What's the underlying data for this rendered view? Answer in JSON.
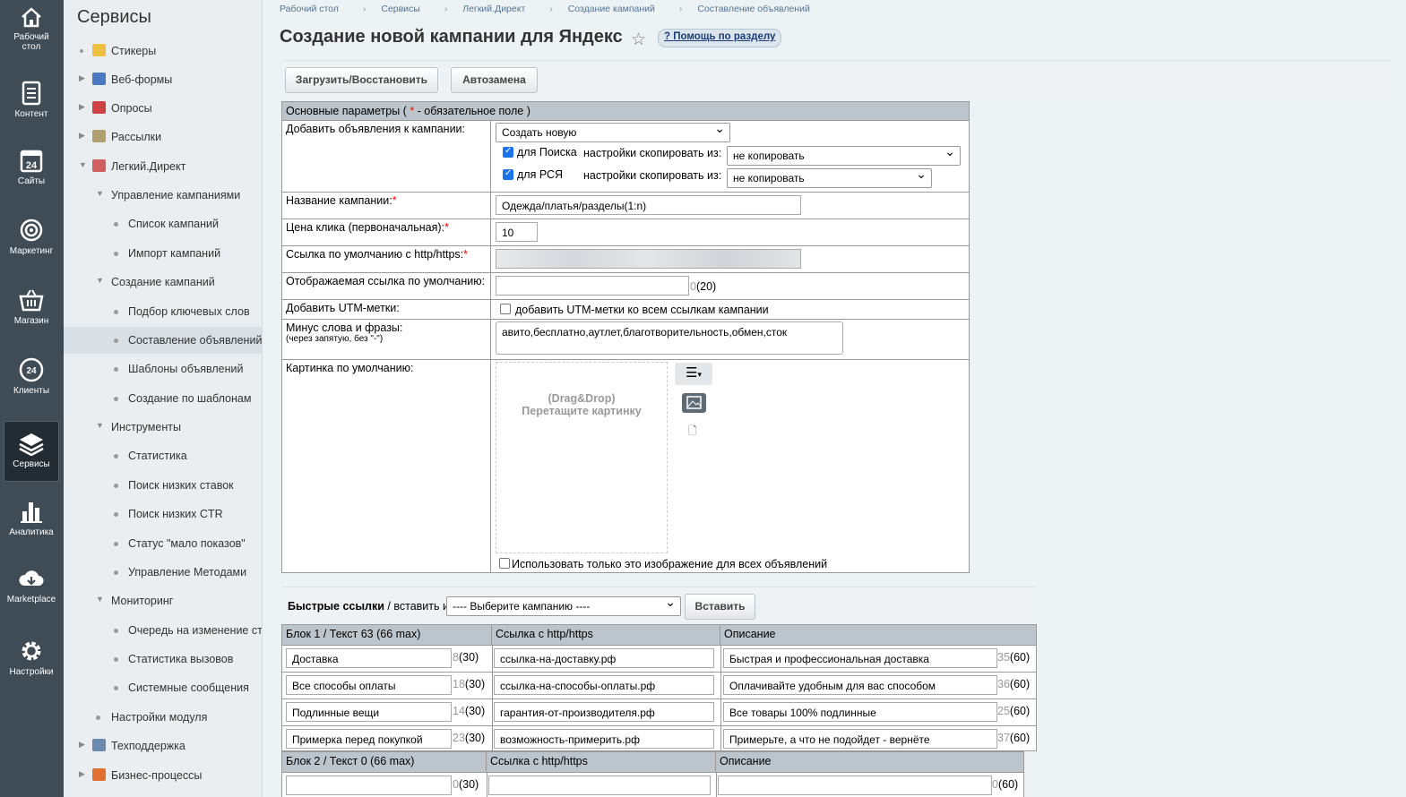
{
  "leftbar": [
    {
      "label": "Рабочий стол",
      "icon": "home-icon"
    },
    {
      "label": "Контент",
      "icon": "document-icon"
    },
    {
      "label": "Сайты",
      "icon": "calendar-24-icon"
    },
    {
      "label": "Маркетинг",
      "icon": "target-icon"
    },
    {
      "label": "Магазин",
      "icon": "basket-icon"
    },
    {
      "label": "Клиенты",
      "icon": "clients-24-icon"
    },
    {
      "label": "Сервисы",
      "icon": "layers-icon"
    },
    {
      "label": "Аналитика",
      "icon": "bar-chart-icon"
    },
    {
      "label": "Marketplace",
      "icon": "cloud-download-icon"
    },
    {
      "label": "Настройки",
      "icon": "gear-icon"
    }
  ],
  "sidebar": {
    "title": "Сервисы",
    "items": [
      {
        "label": "Стикеры"
      },
      {
        "label": "Веб-формы"
      },
      {
        "label": "Опросы"
      },
      {
        "label": "Рассылки"
      },
      {
        "label": "Легкий.Директ"
      },
      {
        "label": "Управление кампаниями"
      },
      {
        "label": "Список кампаний"
      },
      {
        "label": "Импорт кампаний"
      },
      {
        "label": "Создание кампаний"
      },
      {
        "label": "Подбор ключевых слов"
      },
      {
        "label": "Составление объявлений"
      },
      {
        "label": "Шаблоны объявлений"
      },
      {
        "label": "Создание по шаблонам"
      },
      {
        "label": "Инструменты"
      },
      {
        "label": "Статистика"
      },
      {
        "label": "Поиск низких ставок"
      },
      {
        "label": "Поиск низких CTR"
      },
      {
        "label": "Статус \"мало показов\""
      },
      {
        "label": "Управление Методами"
      },
      {
        "label": "Мониторинг"
      },
      {
        "label": "Очередь на изменение ставок"
      },
      {
        "label": "Статистика вызовов"
      },
      {
        "label": "Системные сообщения"
      },
      {
        "label": "Настройки модуля"
      },
      {
        "label": "Техподдержка"
      },
      {
        "label": "Бизнес-процессы"
      }
    ]
  },
  "breadcrumbs": [
    "Рабочий стол",
    "Сервисы",
    "Легкий.Директ",
    "Создание кампаний",
    "Составление объявлений"
  ],
  "page": {
    "title": "Создание новой кампании для Яндекс",
    "help": "Помощь по разделу"
  },
  "toolbar": {
    "load": "Загрузить/Восстановить",
    "replace": "Автозамена"
  },
  "form": {
    "header": "Основные параметры (",
    "header_star": "*",
    "header_tail": " - обязательное поле )",
    "add_label": "Добавить объявления к кампании:",
    "add_select": "Создать новую",
    "search_cb": "для Поиска",
    "rsya_cb": "для РСЯ",
    "copy_label": "настройки скопировать из:",
    "copy_value": "не копировать",
    "name_label": "Название кампании:",
    "name_value": "Одежда/платья/разделы(1:n)",
    "price_label": "Цена клика (первоначальная):",
    "price_value": "10",
    "link_label": "Ссылка по умолчанию с http/https:",
    "link_value": "",
    "display_label": "Отображаемая ссылка по умолчанию:",
    "display_count": "0",
    "display_max": "(20)",
    "utm_label": "Добавить UTM-метки:",
    "utm_cb": "добавить UTM-метки ко всем ссылкам кампании",
    "minus_label": "Минус слова и фразы:",
    "minus_hint": "(через запятую, без \"-\")",
    "minus_value": "авито,бесплатно,аутлет,благотворительность,обмен,сток",
    "image_label": "Картинка по умолчанию:",
    "drop_line1": "(Drag&Drop)",
    "drop_line2": "Перетащите картинку",
    "only_image_cb": "Использовать только это изображение для всех объявлений"
  },
  "quick": {
    "title": "Быстрые ссылки",
    "insert_from": " / вставить из",
    "select": "---- Выберите кампанию ----",
    "insert_btn": "Вставить",
    "col_link": "Ссылка с http/https",
    "col_desc": "Описание",
    "block1": {
      "header": "Блок 1 / Текст 63 (66 max)",
      "rows": [
        {
          "text": "Доставка",
          "tc": "8",
          "link": "ссылка-на-доставку.рф",
          "desc": "Быстрая и профессиональная доставка",
          "dc": "35"
        },
        {
          "text": "Все способы оплаты",
          "tc": "18",
          "link": "ссылка-на-способы-оплаты.рф",
          "desc": "Оплачивайте удобным для вас способом",
          "dc": "36"
        },
        {
          "text": "Подлинные вещи",
          "tc": "14",
          "link": "гарантия-от-производителя.рф",
          "desc": "Все товары 100% подлинные",
          "dc": "25"
        },
        {
          "text": "Примерка перед покупкой",
          "tc": "23",
          "link": "возможность-примерить.рф",
          "desc": "Примерьте, а что не подойдет - вернёте",
          "dc": "37"
        }
      ]
    },
    "block2": {
      "header": "Блок 2 / Текст 0 (66 max)",
      "rows": [
        {
          "text": "",
          "tc": "0",
          "link": "",
          "desc": "",
          "dc": "0"
        }
      ]
    },
    "max30": "(30)",
    "max60": "(60)"
  }
}
